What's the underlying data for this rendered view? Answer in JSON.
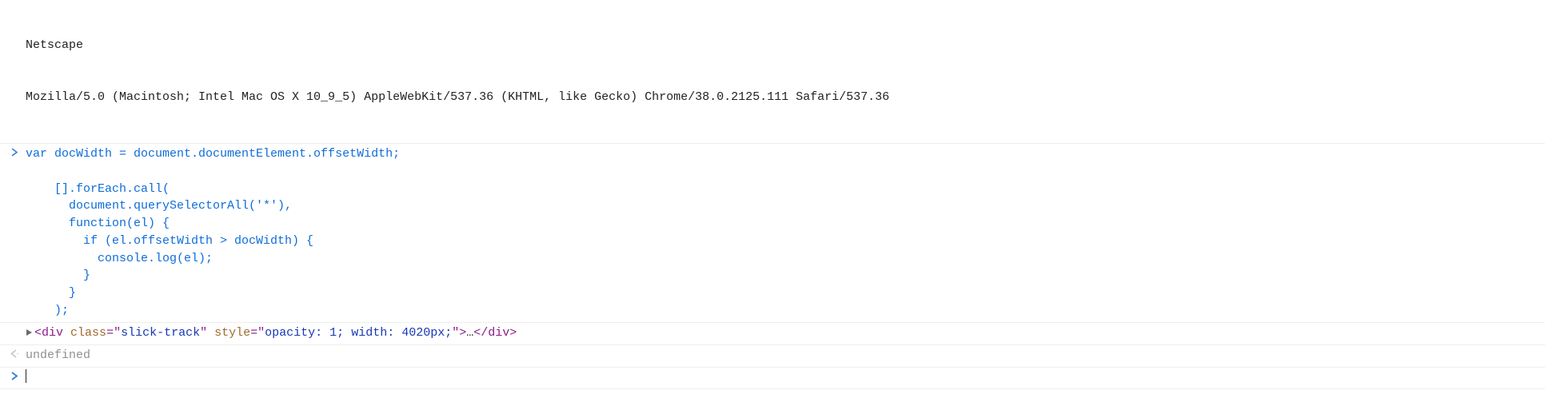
{
  "output": {
    "netscape": "Netscape",
    "ua": "Mozilla/5.0 (Macintosh; Intel Mac OS X 10_9_5) AppleWebKit/537.36 (KHTML, like Gecko) Chrome/38.0.2125.111 Safari/537.36"
  },
  "input": {
    "line1": "var docWidth = document.documentElement.offsetWidth;",
    "blank": "",
    "line2": "    [].forEach.call(",
    "line3": "      document.querySelectorAll('*'),",
    "line4": "      function(el) {",
    "line5": "        if (el.offsetWidth > docWidth) {",
    "line6": "          console.log(el);",
    "line7": "        }",
    "line8": "      }",
    "line9": "    );"
  },
  "log": {
    "open": "<",
    "tag": "div",
    "sp": " ",
    "attr_class": "class",
    "eq": "=\"",
    "val_class": "slick-track",
    "q": "\"",
    "attr_style": "style",
    "val_style": "opacity: 1; width: 4020px;",
    "close_open": ">",
    "ellipsis": "…",
    "open_close": "</",
    "close": ">"
  },
  "result": {
    "undefined": "undefined"
  }
}
